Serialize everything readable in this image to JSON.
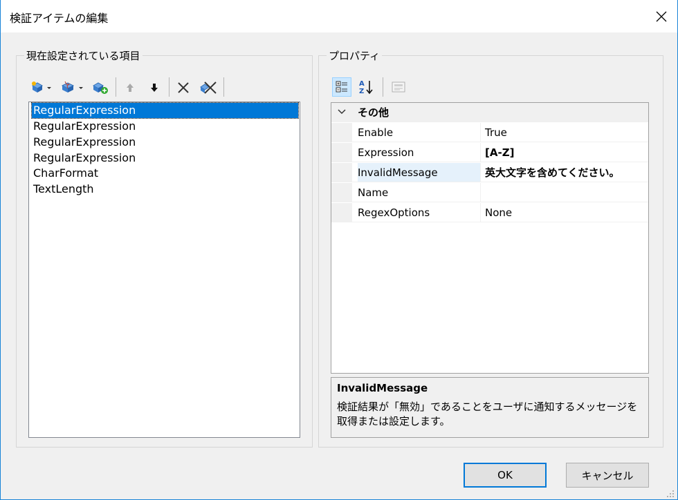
{
  "window": {
    "title": "検証アイテムの編集"
  },
  "left_group": {
    "label": "現在設定されている項目",
    "toolbar": [
      "add-validator-dropdown",
      "add-validator-alt-dropdown",
      "add-item",
      "move-up",
      "move-down",
      "delete",
      "delete-all"
    ],
    "items": [
      {
        "label": "RegularExpression",
        "selected": true
      },
      {
        "label": "RegularExpression"
      },
      {
        "label": "RegularExpression"
      },
      {
        "label": "RegularExpression"
      },
      {
        "label": "CharFormat"
      },
      {
        "label": "TextLength"
      }
    ]
  },
  "right_group": {
    "label": "プロパティ",
    "toolbar": [
      "categorized-view",
      "alphabetical-sort",
      "property-pages"
    ],
    "category": "その他",
    "properties": [
      {
        "name": "Enable",
        "value": "True",
        "bold": false
      },
      {
        "name": "Expression",
        "value": "[A-Z]",
        "bold": true
      },
      {
        "name": "InvalidMessage",
        "value": "英大文字を含めてください。",
        "bold": true
      },
      {
        "name": "Name",
        "value": "",
        "bold": false
      },
      {
        "name": "RegexOptions",
        "value": "None",
        "bold": false
      }
    ],
    "description": {
      "title": "InvalidMessage",
      "text": "検証結果が「無効」であることをユーザに通知するメッセージを取得または設定します。"
    }
  },
  "buttons": {
    "ok": "OK",
    "cancel": "キャンセル"
  },
  "colors": {
    "accent": "#0078d7",
    "border": "#1883d7"
  }
}
